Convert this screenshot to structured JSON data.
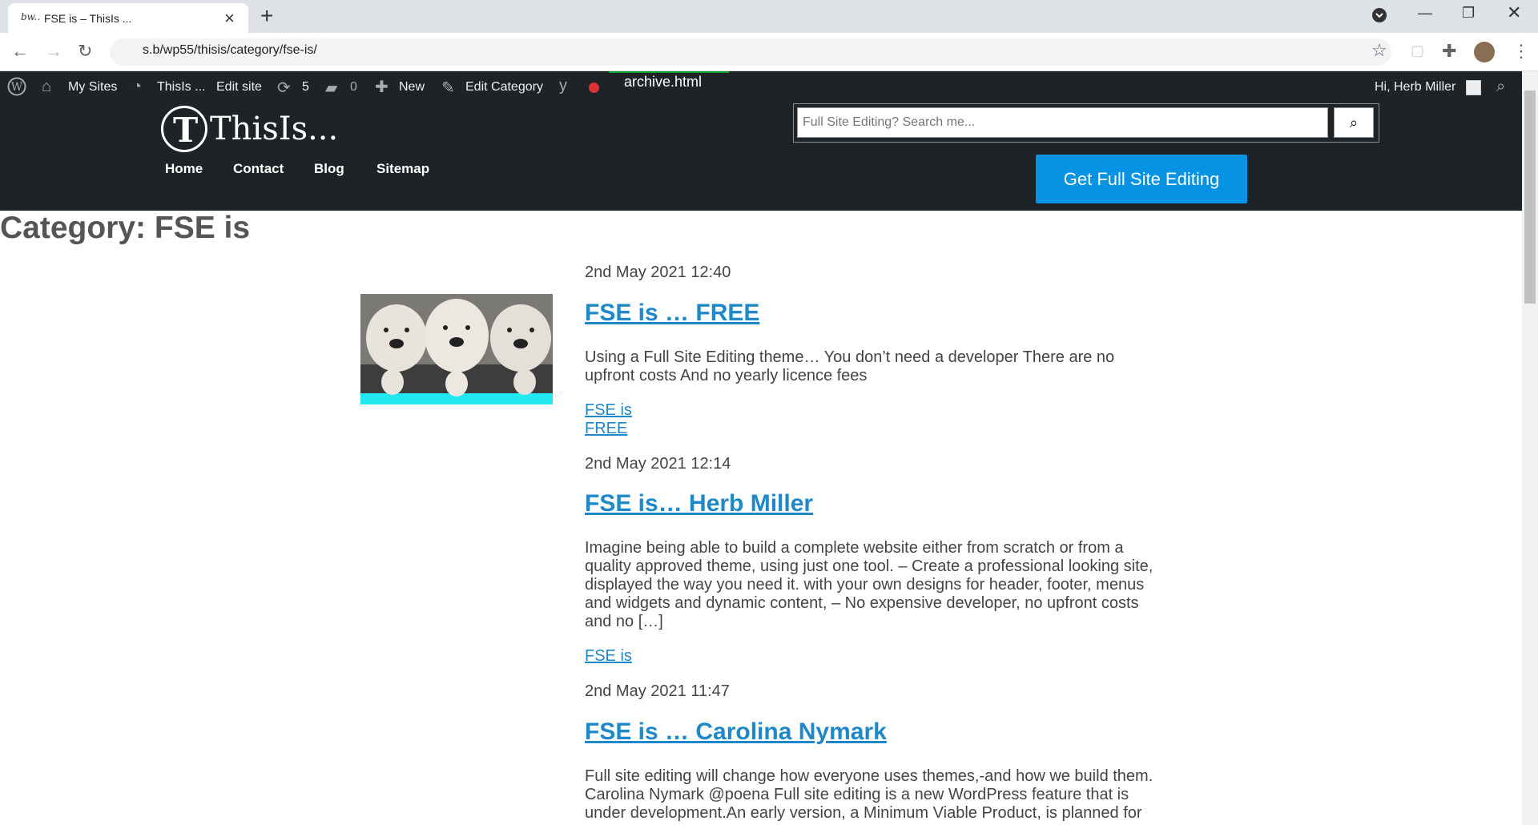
{
  "browser": {
    "tab_title": "FSE is – ThisIs ...",
    "tab_favicon": "bw..",
    "url": "s.b/wp55/thisis/category/fse-is/"
  },
  "adminbar": {
    "my_sites": "My Sites",
    "site_name": "ThisIs ...",
    "edit_site": "Edit site",
    "updates_count": "5",
    "comments_count": "0",
    "new_label": "New",
    "edit_category": "Edit Category",
    "template_name": "archive.html",
    "greeting": "Hi, Herb Miller"
  },
  "site": {
    "logo_text": "ThisIs...",
    "menu": [
      "Home",
      "Contact",
      "Blog",
      "Sitemap"
    ],
    "search_placeholder": "Full Site Editing? Search me...",
    "cta_label": "Get Full Site Editing"
  },
  "page": {
    "heading": "Category: FSE is"
  },
  "posts": [
    {
      "date": "2nd May 2021 12:40",
      "title": "FSE is … FREE",
      "excerpt": "Using a Full Site Editing theme… You don’t need a developer There are no upfront costs And no yearly licence fees",
      "categories": [
        "FSE is",
        "FREE"
      ]
    },
    {
      "date": "2nd May 2021 12:14",
      "title": "FSE is… Herb Miller",
      "excerpt": "Imagine being able to build a complete website either from scratch or from a quality approved theme, using just one tool. – Create a professional looking site, displayed the way you need it. with your own designs for header, footer, menus and widgets and dynamic content, – No expensive developer, no upfront costs and no […]",
      "categories": [
        "FSE is"
      ]
    },
    {
      "date": "2nd May 2021 11:47",
      "title": "FSE is … Carolina Nymark",
      "excerpt": "Full site editing will change how everyone uses themes,-and how we build them. Carolina Nymark @poena Full site editing is a new WordPress feature that is under development.An early version, a Minimum Viable Product, is planned for",
      "categories": []
    }
  ]
}
